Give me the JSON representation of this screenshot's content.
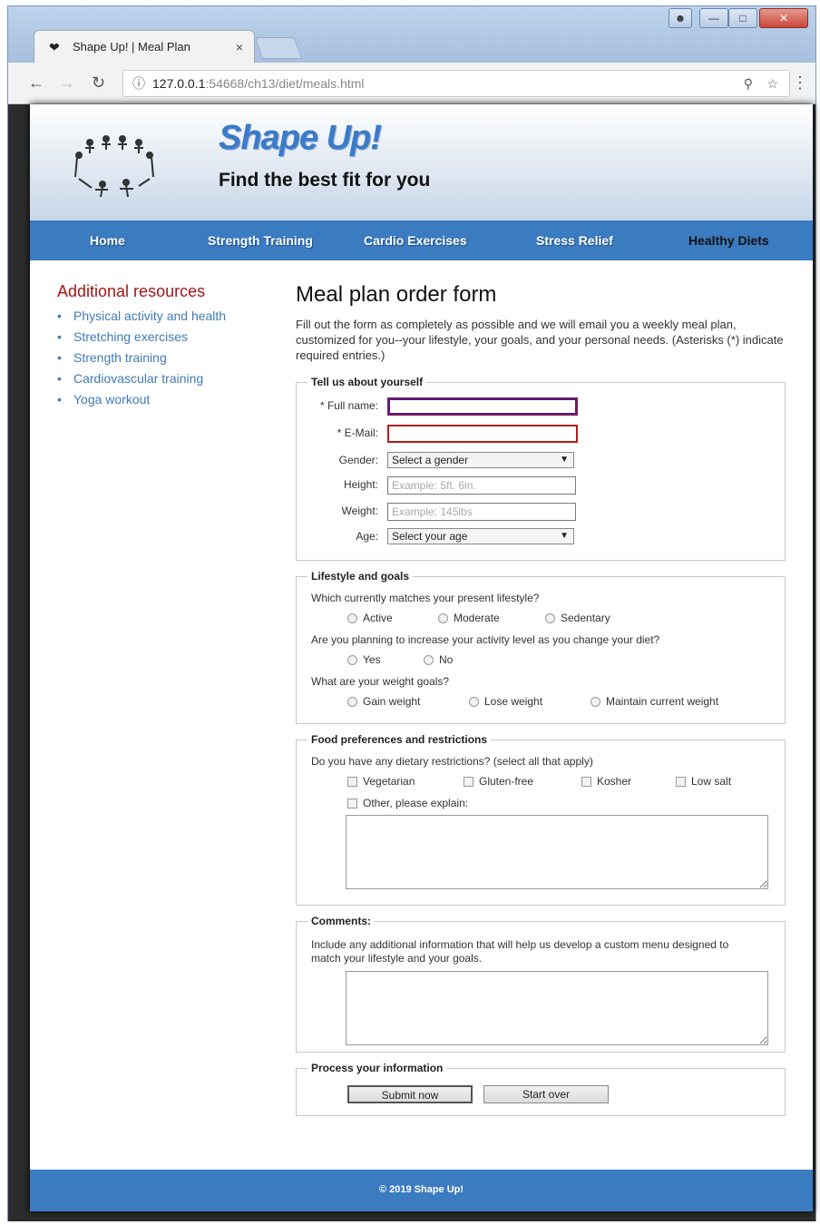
{
  "browser": {
    "tab_title": "Shape Up! | Meal Plan",
    "tab_close": "×",
    "url_host": "127.0.0.1",
    "url_path": ":54668/ch13/diet/meals.html"
  },
  "header": {
    "site_title": "Shape Up!",
    "tagline": "Find the best fit for you"
  },
  "nav": {
    "items": [
      "Home",
      "Strength Training",
      "Cardio Exercises",
      "Stress Relief",
      "Healthy Diets"
    ]
  },
  "sidebar": {
    "heading": "Additional resources",
    "links": [
      "Physical activity and health",
      "Stretching exercises",
      "Strength training",
      "Cardiovascular training",
      "Yoga workout"
    ]
  },
  "main": {
    "title": "Meal plan order form",
    "intro": "Fill out the form as completely as possible and we will email you a weekly meal plan, customized for you--your lifestyle, your goals, and your personal needs. (Asterisks (*) indicate required entries.)"
  },
  "about": {
    "legend": "Tell us about yourself",
    "fullname_label": "* Full name:",
    "email_label": "* E-Mail:",
    "gender_label": "Gender:",
    "gender_value": "Select a gender",
    "height_label": "Height:",
    "height_placeholder": "Example: 5ft. 6in.",
    "weight_label": "Weight:",
    "weight_placeholder": "Example: 145lbs",
    "age_label": "Age:",
    "age_value": "Select your age"
  },
  "lifestyle": {
    "legend": "Lifestyle and goals",
    "q1": "Which currently matches your present lifestyle?",
    "q1_options": [
      "Active",
      "Moderate",
      "Sedentary"
    ],
    "q2": "Are you planning to increase your activity level as you change your diet?",
    "q2_options": [
      "Yes",
      "No"
    ],
    "q3": "What are your weight goals?",
    "q3_options": [
      "Gain weight",
      "Lose weight",
      "Maintain current weight"
    ]
  },
  "food": {
    "legend": "Food preferences and restrictions",
    "q": "Do you have any dietary restrictions? (select all that apply)",
    "options": [
      "Vegetarian",
      "Gluten-free",
      "Kosher",
      "Low salt"
    ],
    "other": "Other, please explain:"
  },
  "comments": {
    "legend": "Comments:",
    "text": "Include any additional information that will help us develop a custom menu designed to match your lifestyle and your goals."
  },
  "process": {
    "legend": "Process your information",
    "submit": "Submit now",
    "reset": "Start over"
  },
  "footer": {
    "text": "© 2019 Shape Up!"
  },
  "colors": {
    "brand_blue": "#3b7bc0",
    "heading_red": "#a31515",
    "link_blue": "#3f7ab8"
  }
}
